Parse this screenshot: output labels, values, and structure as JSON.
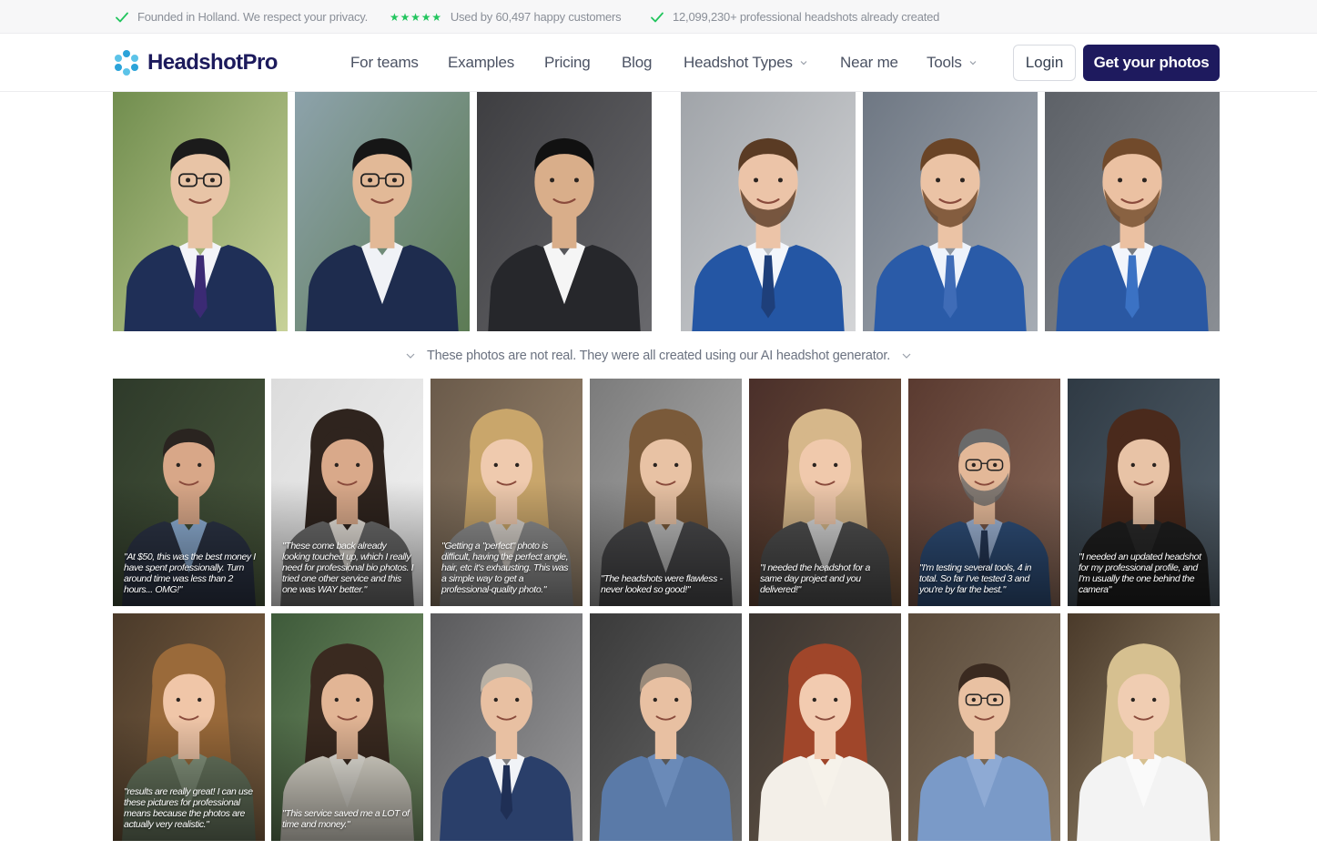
{
  "topbar": {
    "item1": "Founded in Holland. We respect your privacy.",
    "item2": "Used by 60,497 happy customers",
    "item3": "12,099,230+ professional headshots already created",
    "rating_stars": 5
  },
  "nav": {
    "brand": "HeadshotPro",
    "links": [
      "For teams",
      "Examples",
      "Pricing",
      "Blog",
      "Headshot Types",
      "Near me",
      "Tools"
    ],
    "login": "Login",
    "cta": "Get your photos"
  },
  "note": "These photos are not real. They were all created using our AI headshot generator.",
  "colors": {
    "brand_navy": "#1e1a5e",
    "check_green": "#22c55e",
    "logo_blue": "#2ba3d9"
  },
  "examples": [
    "Asian man, navy suit, purple tie, garden background",
    "Asian man, navy suit, adjusting collar, city background",
    "Asian man, charcoal suit, grey studio background",
    "Bearded man, blue suit, navy tie, white pocket square",
    "Bearded man, blue suit, textured tie, office background",
    "Bearded man, blue suit, blue tie, grey background"
  ],
  "reviews_row1": [
    "\"At $50, this was the best money I have spent professionally. Turn around time was less than 2 hours... OMG!\"",
    "\"These come back already looking touched up, which I really need for professional bio photos. I tried one other service and this one was WAY better.\"",
    "\"Getting a \"perfect\" photo is difficult, having the perfect angle, hair, etc it's exhausting. This was a simple way to get a professional-quality photo.\"",
    "\"The headshots were flawless - never looked so good!\"",
    "\"I needed the headshot for a same day project and you delivered!\"",
    "\"I'm testing several tools, 4 in total. So far I've tested 3 and you're by far the best.\"",
    "\"I needed an updated headshot for my professional profile, and I'm usually the one behind the camera\""
  ],
  "reviews_row2": [
    "\"results are really great! I can use these pictures for professional means because the photos are actually very realistic.\"",
    "\"This service saved me a LOT of time and money.\"",
    "",
    "",
    "",
    "",
    ""
  ]
}
